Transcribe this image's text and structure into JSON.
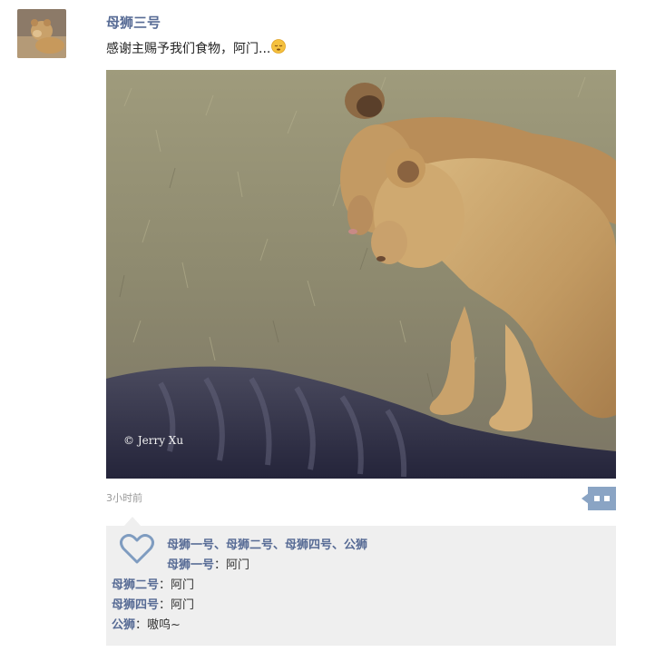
{
  "post": {
    "username": "母狮三号",
    "text": "感谢主赐予我们食物，阿门...",
    "emoji": "sleeping-face-emoji",
    "photo": {
      "watermark": "© Jerry Xu"
    },
    "timestamp": "3小时前"
  },
  "likes": {
    "names": "母狮一号、母狮二号、母狮四号、公狮",
    "icon": "heart-icon"
  },
  "comments": [
    {
      "author": "母狮一号",
      "separator": "：",
      "text": "阿门"
    },
    {
      "author": "母狮二号",
      "separator": "：",
      "text": "阿门"
    },
    {
      "author": "母狮四号",
      "separator": "：",
      "text": "阿门"
    },
    {
      "author": "公狮",
      "separator": "：",
      "text": "嗷呜~"
    }
  ],
  "colors": {
    "name_blue": "#576b95",
    "panel_bg": "#efefef",
    "timestamp_gray": "#999999",
    "comment_button_blue": "#8aa4c4"
  }
}
